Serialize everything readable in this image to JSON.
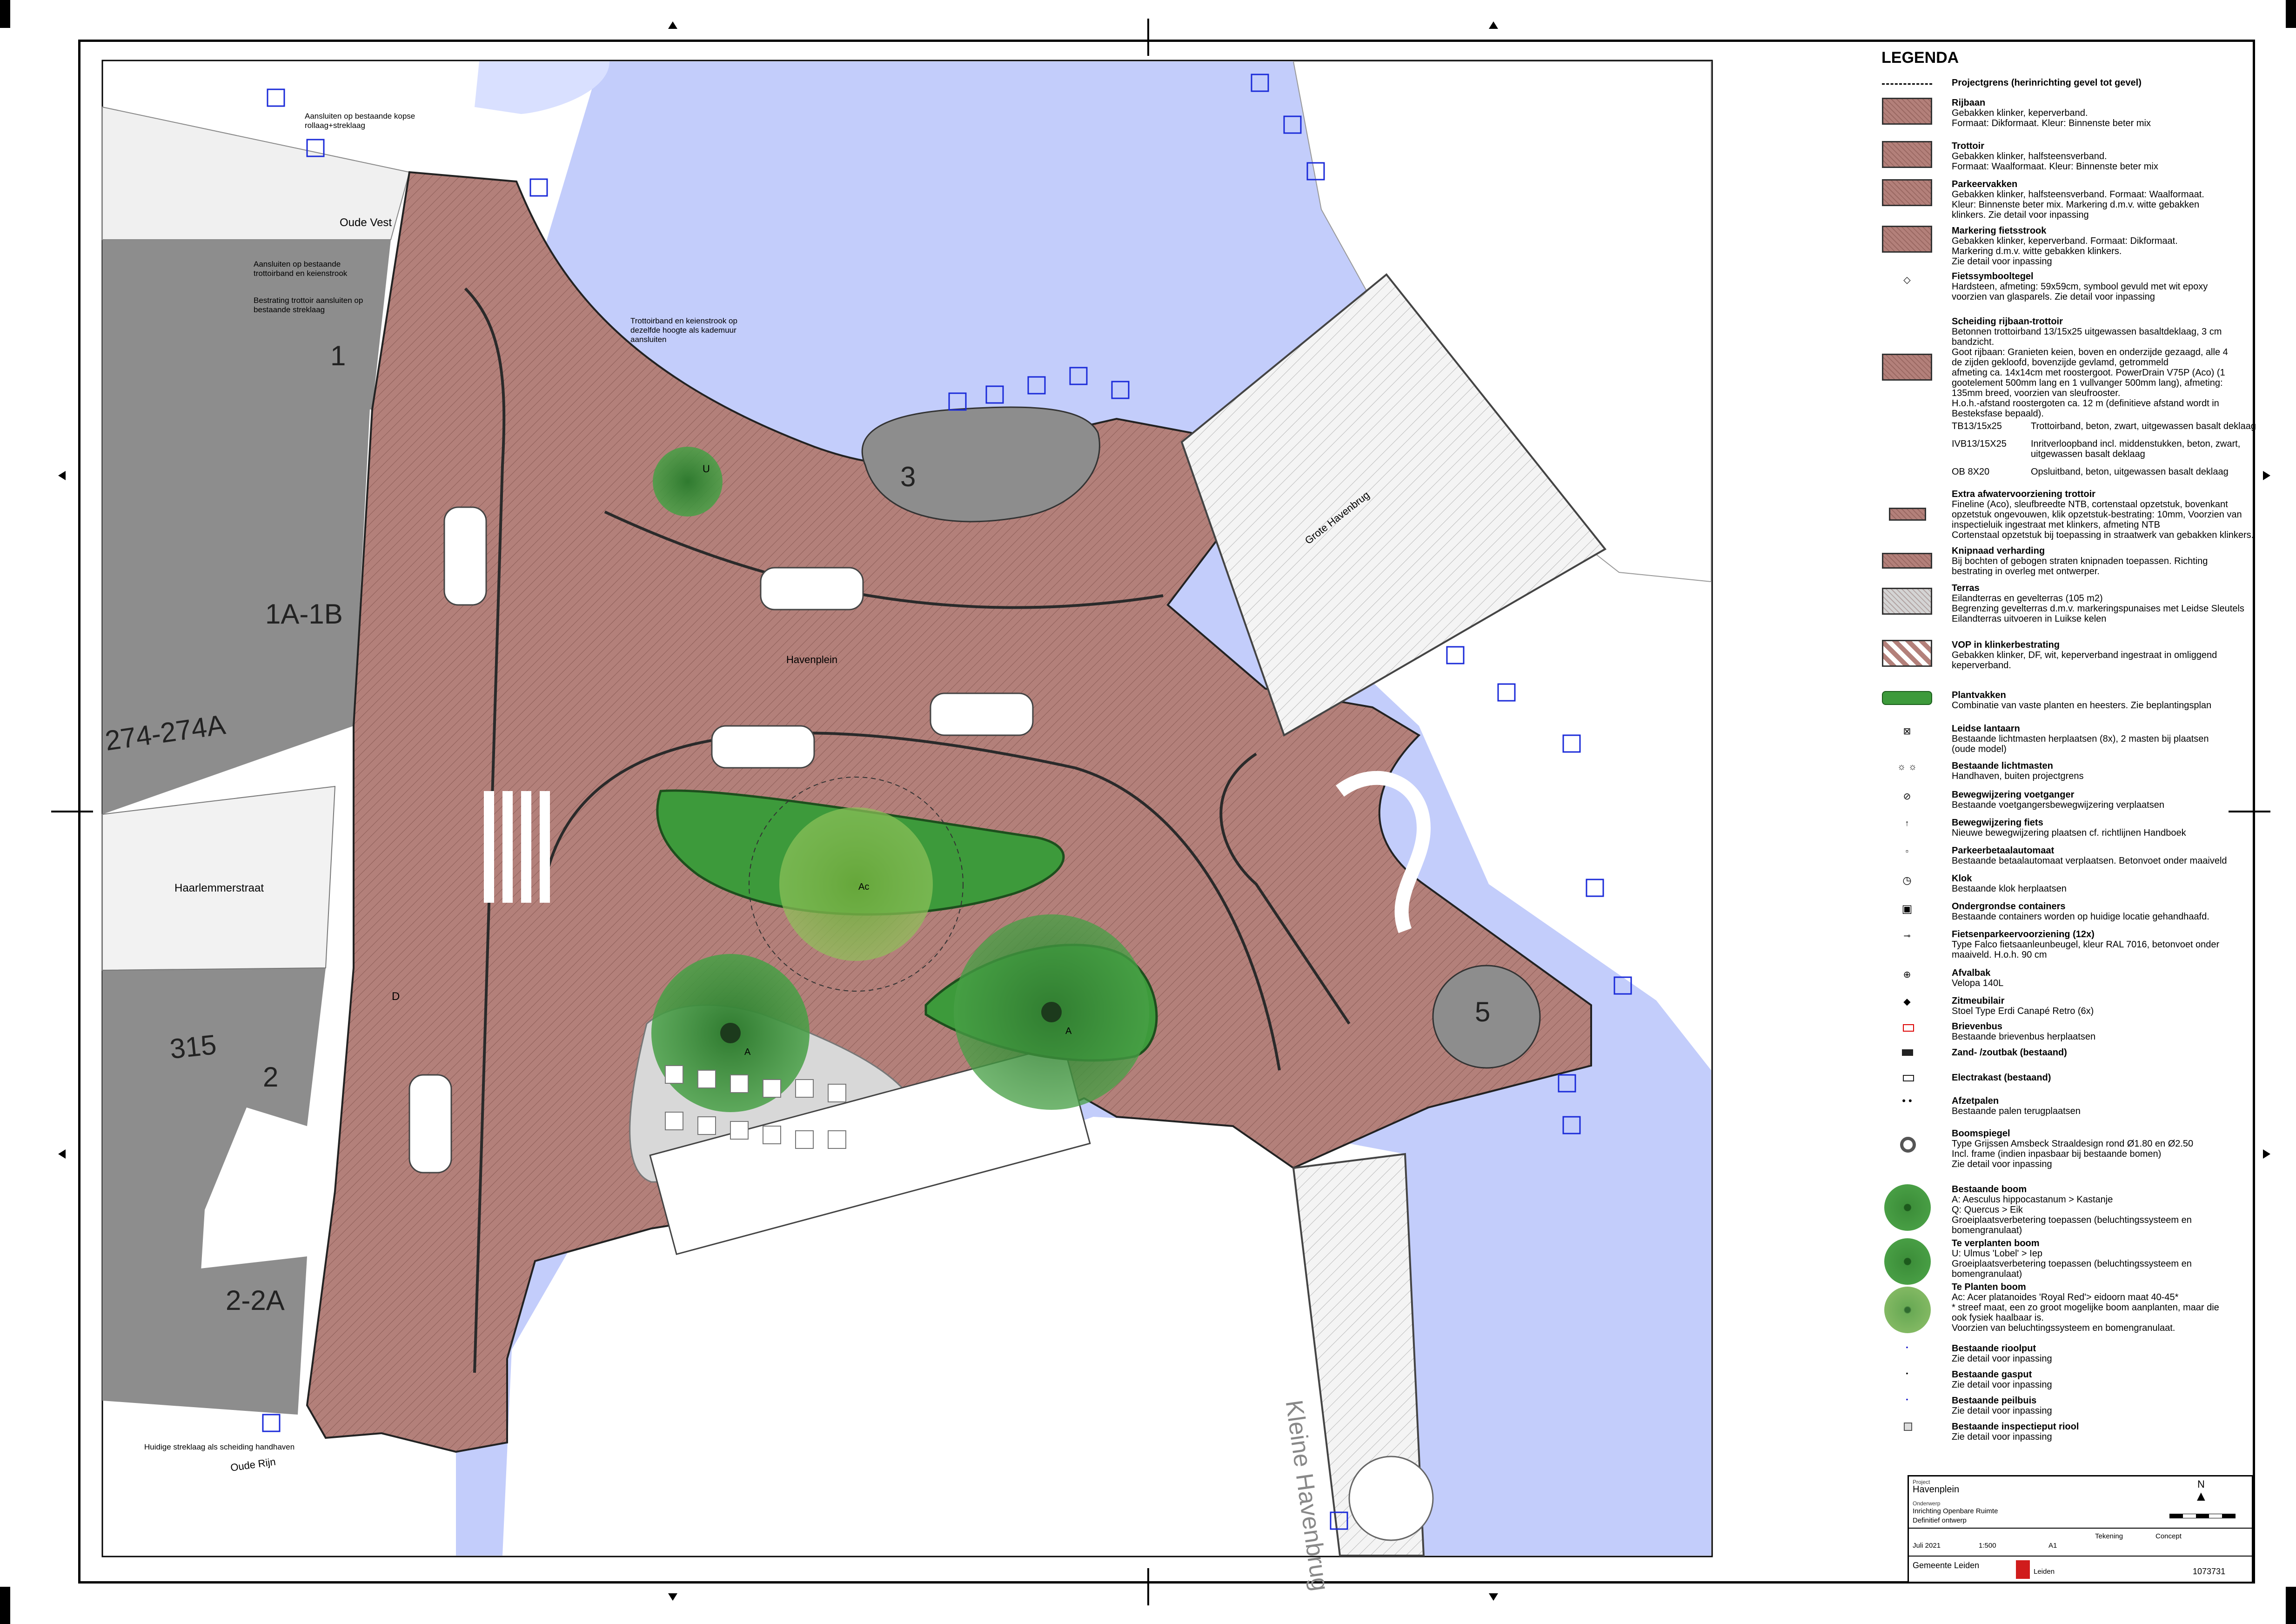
{
  "map": {
    "numbers": {
      "lot1": "1",
      "lot1a1b": "1A-1B",
      "lot274": "274-274A",
      "lot315": "315",
      "lot2": "2",
      "lot22a": "2-2A",
      "island3": "3",
      "island5": "5"
    },
    "streets": {
      "oude_vest": "Oude Vest",
      "haarlemmerstraat": "Haarlemmerstraat",
      "havenplein": "Havenplein",
      "oude_rijn": "Oude Rijn",
      "grote_havenbrug": "Grote Havenbrug",
      "kleine_havenbrug": "Kleine Havenbrug"
    },
    "notes": {
      "n1": "Aansluiten op bestaande kopse rollaag+streklaag",
      "n2": "Aansluiten op bestaande trottoirband en keienstrook",
      "n3": "Bestrating trottoir aansluiten op bestaande streklaag",
      "n4": "Trottoirband en keienstrook op dezelfde hoogte als kademuur aansluiten",
      "n5": "Huidige streklaag als scheiding handhaven"
    },
    "tree_codes": {
      "u": "U",
      "ac": "Ac",
      "a1": "A",
      "a2": "A",
      "d": "D"
    }
  },
  "legend": {
    "title": "LEGENDA",
    "items": [
      {
        "title": "Projectgrens (herinrichting gevel tot gevel)",
        "desc": ""
      },
      {
        "title": "Rijbaan",
        "desc": "Gebakken klinker, keperverband.\nFormaat: Dikformaat. Kleur: Binnenste beter mix"
      },
      {
        "title": "Trottoir",
        "desc": "Gebakken klinker, halfsteensverband.\nFormaat: Waalformaat. Kleur: Binnenste beter mix"
      },
      {
        "title": "Parkeervakken",
        "desc": "Gebakken klinker, halfsteensverband. Formaat: Waalformaat.\nKleur: Binnenste beter mix. Markering d.m.v. witte gebakken\nklinkers. Zie detail voor inpassing"
      },
      {
        "title": "Markering fietsstrook",
        "desc": "Gebakken klinker, keperverband. Formaat: Dikformaat.\nMarkering d.m.v. witte gebakken klinkers.\nZie detail voor inpassing"
      },
      {
        "title": "Fietssymbooltegel",
        "desc": "Hardsteen, afmeting: 59x59cm, symbool gevuld met wit epoxy\nvoorzien van glasparels. Zie detail voor inpassing"
      },
      {
        "title": "Scheiding rijbaan-trottoir",
        "desc": "Betonnen trottoirband 13/15x25 uitgewassen basaltdeklaag, 3 cm\nbandzicht.\nGoot rijbaan: Granieten keien, boven en onderzijde gezaagd, alle 4\nde zijden gekloofd, bovenzijde gevlamd, getrommeld\nafmeting ca. 14x14cm met roostergoot. PowerDrain V75P (Aco) (1\ngootelement 500mm lang en 1 vullvanger 500mm lang), afmeting:\n135mm breed, voorzien van sleufrooster.\nH.o.h.-afstand roostergoten ca. 12 m (definitieve afstand wordt in\nBesteksfase bepaald)."
      },
      {
        "title": "Extra afwatervoorziening trottoir",
        "desc": "Fineline (Aco), sleufbreedte NTB, cortenstaal opzetstuk, bovenkant\nopzetstuk ongevouwen, klik opzetstuk-bestrating: 10mm, Voorzien van\ninspectieluik ingestraat met klinkers, afmeting NTB\nCortenstaal opzetstuk bij toepassing in straatwerk van gebakken klinkers."
      },
      {
        "title": "Knipnaad verharding",
        "desc": "Bij bochten of gebogen straten knipnaden toepassen. Richting\nbestrating in overleg met ontwerper."
      },
      {
        "title": "Terras",
        "desc": "Eilandterras en gevelterras (105 m2)\nBegrenzing gevelterras d.m.v. markeringspunaises met Leidse Sleutels\nEilandterras uitvoeren in Luikse kelen"
      },
      {
        "title": "VOP in klinkerbestrating",
        "desc": "Gebakken klinker, DF, wit, keperverband ingestraat in omliggend\nkeperverband."
      },
      {
        "title": "Plantvakken",
        "desc": "Combinatie van vaste planten en heesters. Zie beplantingsplan"
      },
      {
        "title": "Leidse lantaarn",
        "desc": "Bestaande lichtmasten herplaatsen (8x), 2 masten bij plaatsen\n(oude model)"
      },
      {
        "title": "Bestaande lichtmasten",
        "desc": "Handhaven, buiten projectgrens"
      },
      {
        "title": "Bewegwijzering voetganger",
        "desc": "Bestaande voetgangersbewegwijzering verplaatsen"
      },
      {
        "title": "Bewegwijzering fiets",
        "desc": "Nieuwe bewegwijzering plaatsen cf. richtlijnen Handboek"
      },
      {
        "title": "Parkeerbetaalautomaat",
        "desc": "Bestaande betaalautomaat verplaatsen. Betonvoet onder maaiveld"
      },
      {
        "title": "Klok",
        "desc": "Bestaande klok herplaatsen"
      },
      {
        "title": "Ondergrondse containers",
        "desc": "Bestaande containers worden op huidige locatie gehandhaafd."
      },
      {
        "title": "Fietsenparkeervoorziening (12x)",
        "desc": "Type Falco fietsaanleunbeugel, kleur RAL 7016, betonvoet onder\nmaaiveld. H.o.h. 90 cm"
      },
      {
        "title": "Afvalbak",
        "desc": "Velopa 140L"
      },
      {
        "title": "Zitmeubilair",
        "desc": "Stoel Type Erdi Canapé Retro (6x)"
      },
      {
        "title": "Brievenbus",
        "desc": "Bestaande brievenbus herplaatsen"
      },
      {
        "title": "Zand- /zoutbak (bestaand)",
        "desc": ""
      },
      {
        "title": "Electrakast (bestaand)",
        "desc": ""
      },
      {
        "title": "Afzetpalen",
        "desc": "Bestaande palen terugplaatsen"
      },
      {
        "title": "Boomspiegel",
        "desc": "Type Grijssen Amsbeck Straaldesign rond  Ø1.80 en Ø2.50\nIncl. frame (indien inpasbaar bij bestaande bomen)\nZie detail voor inpassing"
      },
      {
        "title": "Bestaande boom",
        "desc": "A: Aesculus hippocastanum > Kastanje\nQ: Quercus > Eik\nGroeiplaatsverbetering toepassen (beluchtingssysteem en bomengranulaat)"
      },
      {
        "title": "Te verplanten boom",
        "desc": "U: Ulmus 'Lobel' > Iep\nGroeiplaatsverbetering toepassen (beluchtingssysteem en bomengranulaat)"
      },
      {
        "title": "Te Planten boom",
        "desc": "Ac: Acer platanoides 'Royal Red'> eidoorn maat 40-45*\n* streef maat, een zo groot mogelijke boom aanplanten, maar die\nook fysiek haalbaar is.\nVoorzien van beluchtingssysteem en bomengranulaat."
      },
      {
        "title": "Bestaande rioolput",
        "desc": "Zie detail voor inpassing"
      },
      {
        "title": "Bestaande gasput",
        "desc": "Zie detail voor inpassing"
      },
      {
        "title": "Bestaande peilbuis",
        "desc": "Zie detail voor inpassing"
      },
      {
        "title": "Bestaande inspectieput riool",
        "desc": "Zie detail voor inpassing"
      }
    ],
    "kerbs": [
      {
        "code": "TB13/15x25",
        "text": "Trottoirband, beton, zwart, uitgewassen basalt deklaag"
      },
      {
        "code": "IVB13/15X25",
        "text": "Inritverloopband incl. middenstukken, beton, zwart, uitgewassen basalt deklaag"
      },
      {
        "code": "OB 8X20",
        "text": "Opsluitband, beton, uitgewassen basalt deklaag"
      }
    ]
  },
  "title_block": {
    "project_label": "Project",
    "project": "Havenplein",
    "subject_label": "Onderwerp",
    "subject": "Inrichting Openbare Ruimte",
    "status": "Definitief ontwerp",
    "north": "N",
    "date": "Juli 2021",
    "scale": "1:500",
    "format": "A1",
    "type": "Tekening",
    "status2": "Concept",
    "drawing_nr": "1073731",
    "org": "Gemeente Leiden",
    "org_sub": "Leiden"
  },
  "colors": {
    "water": "#c3cdfb",
    "pavement": "#b3807a",
    "building": "#8d8d8d",
    "green": "#3d9a3b"
  }
}
